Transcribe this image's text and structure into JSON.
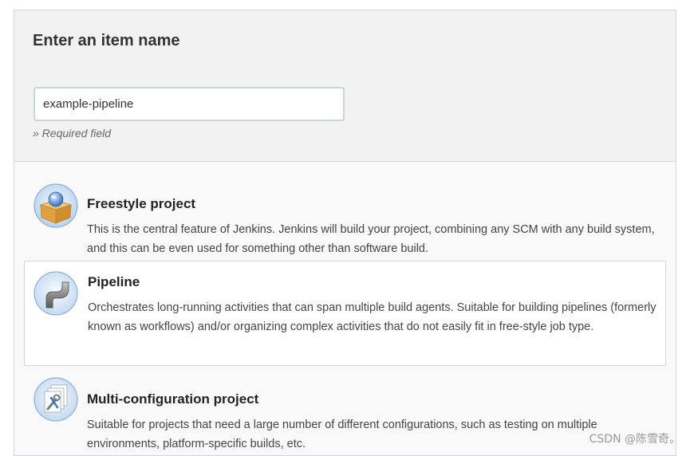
{
  "name_section": {
    "title": "Enter an item name",
    "input_value": "example-pipeline",
    "required_note": "» Required field"
  },
  "items": [
    {
      "title": "Freestyle project",
      "description": "This is the central feature of Jenkins. Jenkins will build your project, combining any SCM with any build system, and this can be even used for something other than software build.",
      "icon": "freestyle-project-icon",
      "selected": false
    },
    {
      "title": "Pipeline",
      "description": "Orchestrates long-running activities that can span multiple build agents. Suitable for building pipelines (formerly known as workflows) and/or organizing complex activities that do not easily fit in free-style job type.",
      "icon": "pipeline-icon",
      "selected": true
    },
    {
      "title": "Multi-configuration project",
      "description": "Suitable for projects that need a large number of different configurations, such as testing on multiple environments, platform-specific builds, etc.",
      "icon": "multi-configuration-icon",
      "selected": false
    }
  ],
  "watermark": "CSDN @陈雪奇。"
}
